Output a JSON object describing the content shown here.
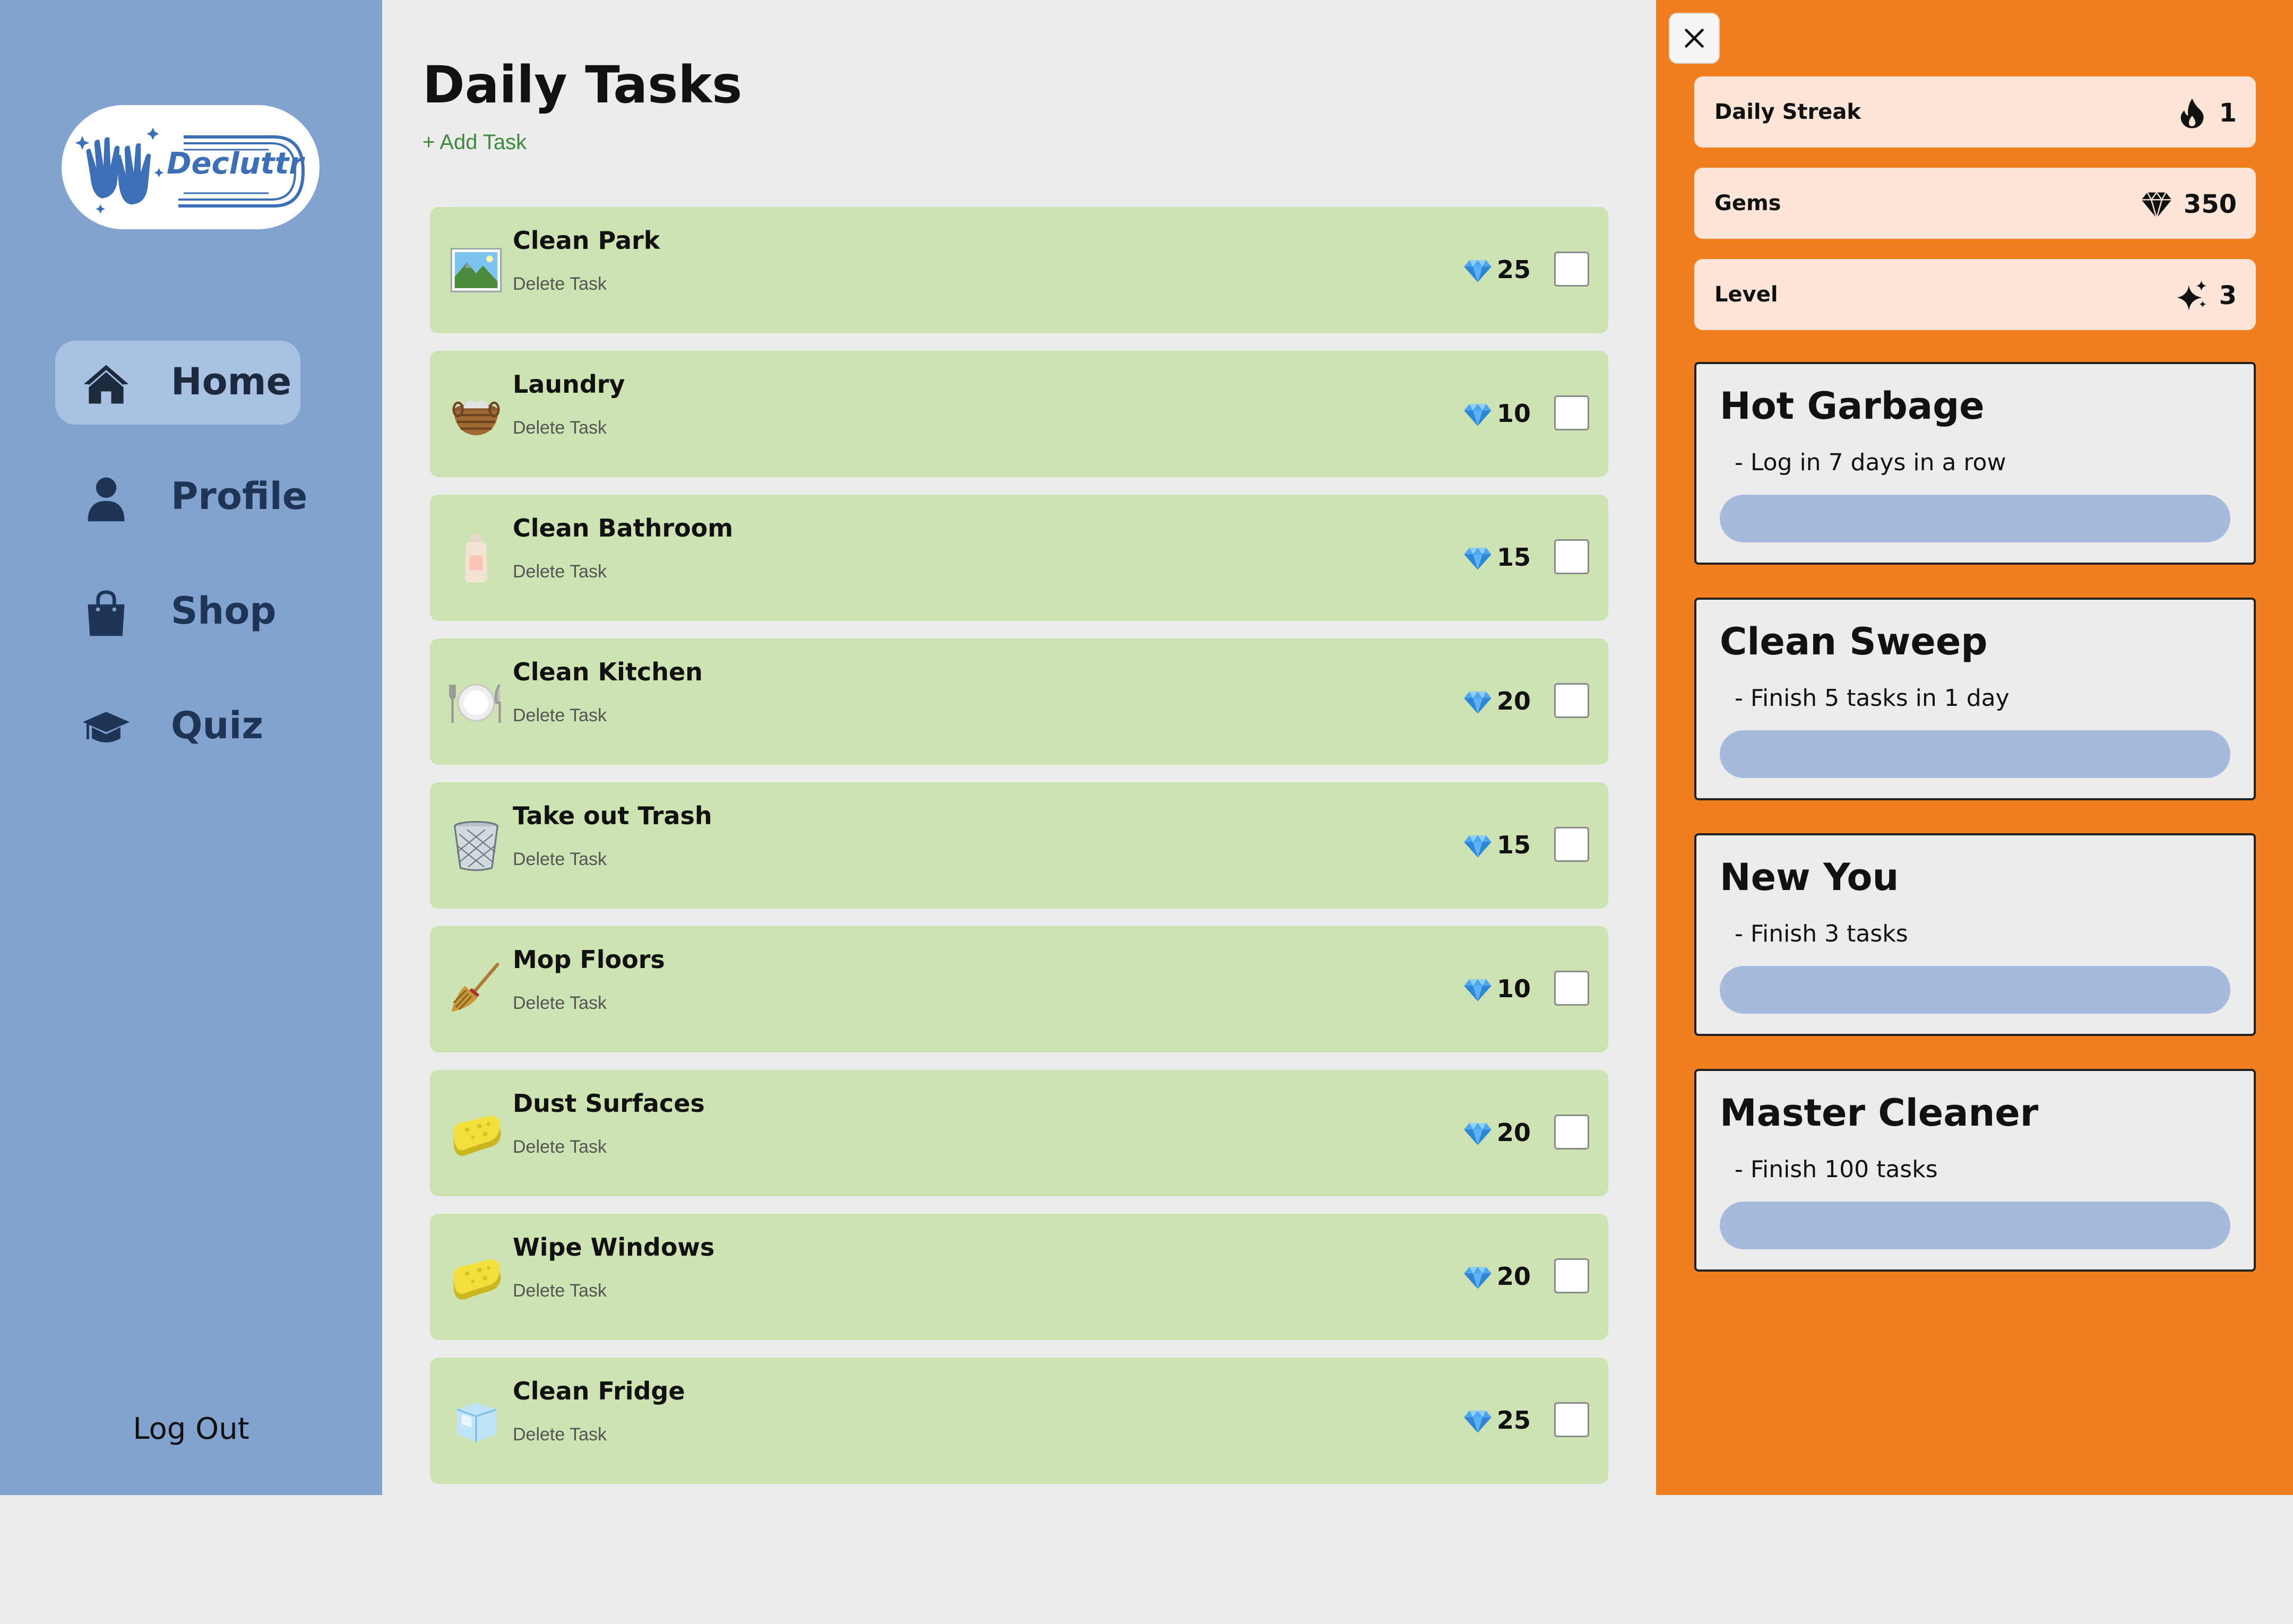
{
  "app": {
    "brand": "Decluttr"
  },
  "sidebar": {
    "items": [
      {
        "label": "Home",
        "icon": "home-icon",
        "active": true
      },
      {
        "label": "Profile",
        "icon": "user-icon",
        "active": false
      },
      {
        "label": "Shop",
        "icon": "shopping-bag-icon",
        "active": false
      },
      {
        "label": "Quiz",
        "icon": "graduation-cap-icon",
        "active": false
      }
    ],
    "logout_label": "Log Out"
  },
  "main": {
    "title": "Daily Tasks",
    "add_task_label": "+ Add Task",
    "delete_label": "Delete Task",
    "tasks": [
      {
        "name": "Clean Park",
        "gems": "25",
        "icon": "park-picture-icon",
        "checked": false
      },
      {
        "name": "Laundry",
        "gems": "10",
        "icon": "laundry-basket-icon",
        "checked": false
      },
      {
        "name": "Clean Bathroom",
        "gems": "15",
        "icon": "lotion-bottle-icon",
        "checked": false
      },
      {
        "name": "Clean Kitchen",
        "gems": "20",
        "icon": "plate-cutlery-icon",
        "checked": false
      },
      {
        "name": "Take out Trash",
        "gems": "15",
        "icon": "wastebasket-icon",
        "checked": false
      },
      {
        "name": "Mop Floors",
        "gems": "10",
        "icon": "broom-icon",
        "checked": false
      },
      {
        "name": "Dust Surfaces",
        "gems": "20",
        "icon": "sponge-icon",
        "checked": false
      },
      {
        "name": "Wipe Windows",
        "gems": "20",
        "icon": "sponge-icon",
        "checked": false
      },
      {
        "name": "Clean Fridge",
        "gems": "25",
        "icon": "ice-cube-icon",
        "checked": false
      }
    ]
  },
  "panel": {
    "stats": [
      {
        "label": "Daily Streak",
        "value": "1",
        "icon": "fire-icon"
      },
      {
        "label": "Gems",
        "value": "350",
        "icon": "gem-icon"
      },
      {
        "label": "Level",
        "value": "3",
        "icon": "sparkles-icon"
      }
    ],
    "achievements": [
      {
        "title": "Hot Garbage",
        "description": "- Log in 7 days in a row",
        "progress": 0
      },
      {
        "title": "Clean Sweep",
        "description": "- Finish 5 tasks in 1 day",
        "progress": 0
      },
      {
        "title": "New You",
        "description": "- Finish 3 tasks",
        "progress": 0
      },
      {
        "title": "Master Cleaner",
        "description": "- Finish 100 tasks",
        "progress": 0
      }
    ]
  },
  "colors": {
    "sidebar": "#82a3cf",
    "active_nav": "#a9c2e4",
    "task_card": "#cde3b1",
    "panel": "#f27f1e",
    "stat_card": "#fde6d7",
    "progress_track": "#a6bade",
    "add_task_text": "#3b8a3b"
  }
}
